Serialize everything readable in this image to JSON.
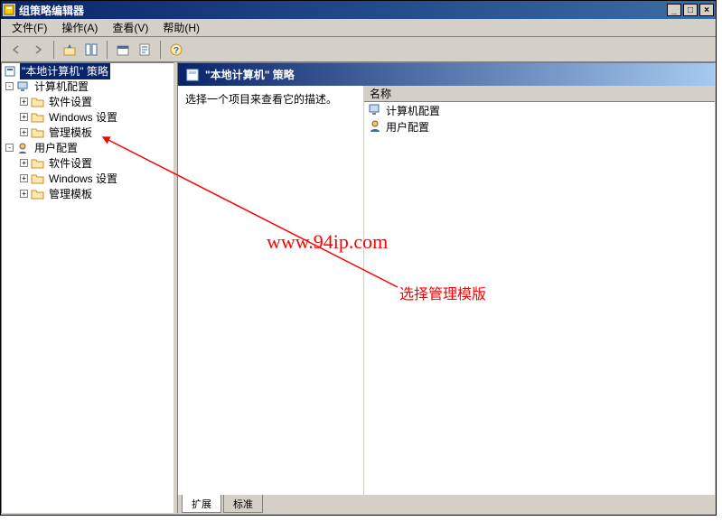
{
  "window": {
    "title": "组策略编辑器"
  },
  "menu": {
    "file": "文件(F)",
    "action": "操作(A)",
    "view": "查看(V)",
    "help": "帮助(H)"
  },
  "tree": {
    "root": "\"本地计算机\" 策略",
    "computer_config": "计算机配置",
    "software_settings": "软件设置",
    "windows_settings": "Windows 设置",
    "admin_templates": "管理模板",
    "user_config": "用户配置"
  },
  "right": {
    "header": "\"本地计算机\" 策略",
    "description": "选择一个项目来查看它的描述。",
    "column_name": "名称",
    "items": {
      "computer_config": "计算机配置",
      "user_config": "用户配置"
    }
  },
  "tabs": {
    "extended": "扩展",
    "standard": "标准"
  },
  "annotations": {
    "watermark": "www.94ip.com",
    "hint": "选择管理模版"
  }
}
